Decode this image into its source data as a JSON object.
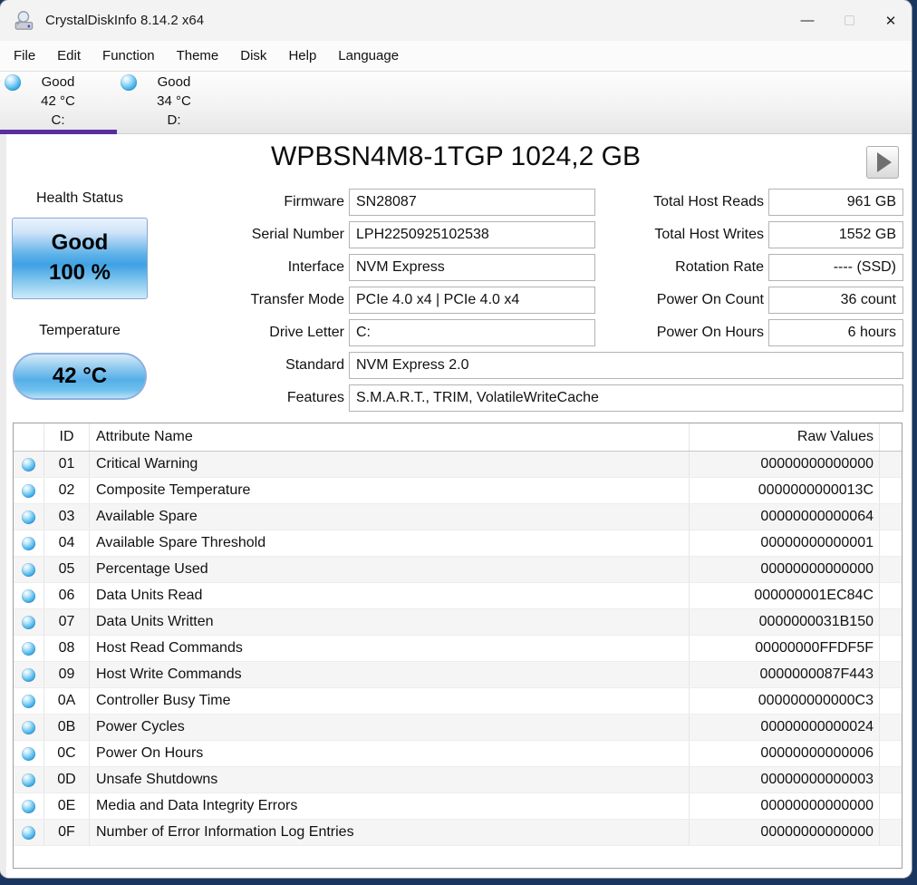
{
  "window": {
    "title": "CrystalDiskInfo 8.14.2 x64",
    "minimize_glyph": "—",
    "close_glyph": "✕"
  },
  "menu": {
    "items": [
      "File",
      "Edit",
      "Function",
      "Theme",
      "Disk",
      "Help",
      "Language"
    ]
  },
  "tabs": [
    {
      "status": "Good",
      "temp": "42 °C",
      "letter": "C:",
      "selected": true
    },
    {
      "status": "Good",
      "temp": "34 °C",
      "letter": "D:",
      "selected": false
    }
  ],
  "drive": {
    "title": "WPBSN4M8-1TGP 1024,2 GB"
  },
  "health": {
    "label": "Health Status",
    "status": "Good",
    "percent": "100 %"
  },
  "temperature": {
    "label": "Temperature",
    "value": "42 °C"
  },
  "fields_left": [
    {
      "label": "Firmware",
      "value": "SN28087",
      "wide": false
    },
    {
      "label": "Serial Number",
      "value": "LPH2250925102538",
      "wide": false
    },
    {
      "label": "Interface",
      "value": "NVM Express",
      "wide": false
    },
    {
      "label": "Transfer Mode",
      "value": "PCIe 4.0 x4 | PCIe 4.0 x4",
      "wide": false
    },
    {
      "label": "Drive Letter",
      "value": "C:",
      "wide": false
    },
    {
      "label": "Standard",
      "value": "NVM Express 2.0",
      "wide": true
    },
    {
      "label": "Features",
      "value": "S.M.A.R.T., TRIM, VolatileWriteCache",
      "wide": true
    }
  ],
  "fields_right": [
    {
      "label": "Total Host Reads",
      "value": "961 GB"
    },
    {
      "label": "Total Host Writes",
      "value": "1552 GB"
    },
    {
      "label": "Rotation Rate",
      "value": "---- (SSD)"
    },
    {
      "label": "Power On Count",
      "value": "36 count"
    },
    {
      "label": "Power On Hours",
      "value": "6 hours"
    }
  ],
  "smart_table": {
    "headers": {
      "id": "ID",
      "name": "Attribute Name",
      "raw": "Raw Values"
    },
    "rows": [
      {
        "id": "01",
        "name": "Critical Warning",
        "raw": "00000000000000"
      },
      {
        "id": "02",
        "name": "Composite Temperature",
        "raw": "0000000000013C"
      },
      {
        "id": "03",
        "name": "Available Spare",
        "raw": "00000000000064"
      },
      {
        "id": "04",
        "name": "Available Spare Threshold",
        "raw": "00000000000001"
      },
      {
        "id": "05",
        "name": "Percentage Used",
        "raw": "00000000000000"
      },
      {
        "id": "06",
        "name": "Data Units Read",
        "raw": "000000001EC84C"
      },
      {
        "id": "07",
        "name": "Data Units Written",
        "raw": "0000000031B150"
      },
      {
        "id": "08",
        "name": "Host Read Commands",
        "raw": "00000000FFDF5F"
      },
      {
        "id": "09",
        "name": "Host Write Commands",
        "raw": "0000000087F443"
      },
      {
        "id": "0A",
        "name": "Controller Busy Time",
        "raw": "000000000000C3"
      },
      {
        "id": "0B",
        "name": "Power Cycles",
        "raw": "00000000000024"
      },
      {
        "id": "0C",
        "name": "Power On Hours",
        "raw": "00000000000006"
      },
      {
        "id": "0D",
        "name": "Unsafe Shutdowns",
        "raw": "00000000000003"
      },
      {
        "id": "0E",
        "name": "Media and Data Integrity Errors",
        "raw": "00000000000000"
      },
      {
        "id": "0F",
        "name": "Number of Error Information Log Entries",
        "raw": "00000000000000"
      }
    ]
  },
  "colors": {
    "accent_purple": "#5b2da0",
    "status_blue": "#3fa2e4",
    "desktop_blue": "#1a3560"
  }
}
